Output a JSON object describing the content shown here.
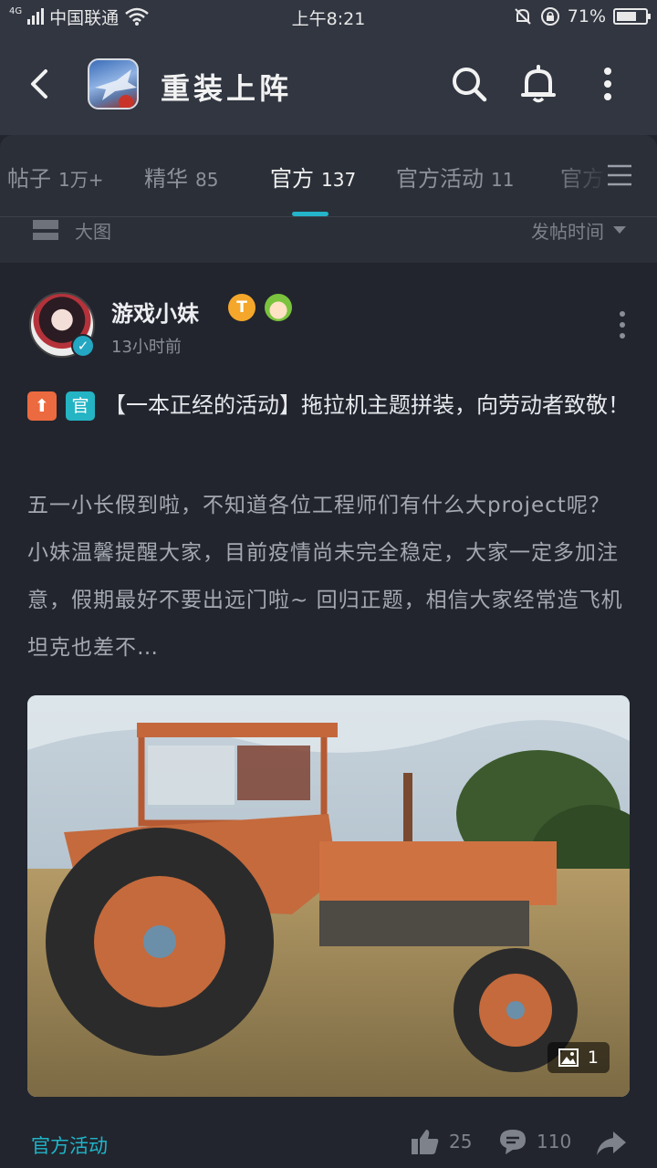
{
  "status_bar": {
    "network": "4G",
    "carrier": "中国联通",
    "time": "上午8:21",
    "battery_text": "71%",
    "battery_level": 0.71
  },
  "app_bar": {
    "title": "重装上阵",
    "icons": [
      "back-icon",
      "search-icon",
      "bell-icon",
      "more-vertical-icon"
    ]
  },
  "tabs": [
    {
      "label": "帖子",
      "count": "1万+"
    },
    {
      "label": "精华",
      "count": "85"
    },
    {
      "label": "官方",
      "count": "137"
    },
    {
      "label": "官方活动",
      "count": "11"
    },
    {
      "label": "官方",
      "count": ""
    }
  ],
  "active_tab_index": 2,
  "filter": {
    "view_mode": "大图",
    "sort": "发帖时间"
  },
  "post": {
    "author": "游戏小妹",
    "level_badge": "T",
    "time": "13小时前",
    "tags": [
      "置顶",
      "官"
    ],
    "tag_up_glyph": "⬆",
    "tag_official": "官",
    "title": "【一本正经的活动】拖拉机主题拼装，向劳动者致敬！",
    "body": "五一小长假到啦，不知道各位工程师们有什么大project呢？小妹温馨提醒大家，目前疫情尚未完全稳定，大家一定多加注意，假期最好不要出远门啦~ 回归正题，相信大家经常造飞机坦克也差不…",
    "image_count": "1",
    "category": "官方活动",
    "likes": "25",
    "comments": "110"
  },
  "colors": {
    "accent": "#24b3c9",
    "tag_up": "#ec6a3f",
    "tag_official": "#24b4c4",
    "background": "#22252e",
    "header": "#313641"
  }
}
